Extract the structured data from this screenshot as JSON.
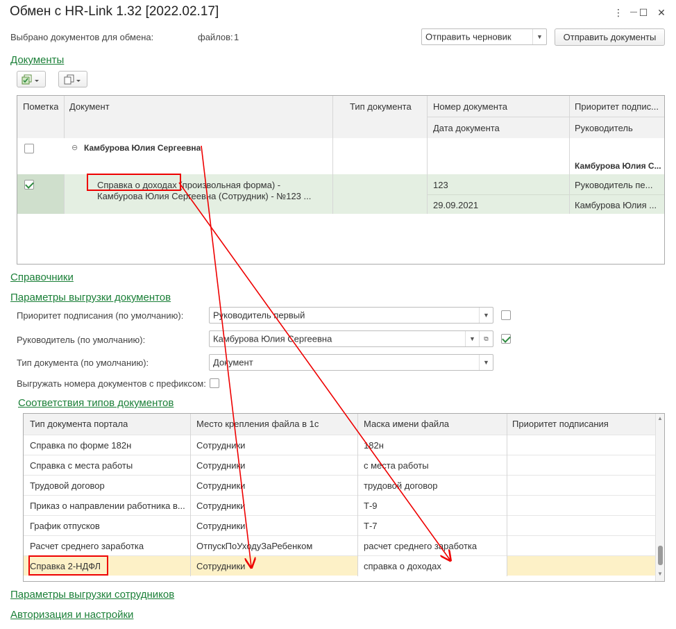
{
  "window": {
    "title": "Обмен с HR-Link 1.32 [2022.02.17]",
    "menu_glyph": "⋮",
    "minimize_glyph": "—",
    "maximize_glyph": "☐",
    "close_glyph": "✕"
  },
  "top": {
    "selected_label": "Выбрано документов для обмена:",
    "files_label": "файлов:",
    "files_count": "1",
    "mode_select": "Отправить черновик",
    "send_button": "Отправить документы"
  },
  "sections": {
    "documents": "Документы",
    "references": "Справочники",
    "export_params": "Параметры выгрузки документов",
    "type_mapping": "Соответствия типов документов",
    "employee_export": "Параметры выгрузки сотрудников",
    "auth": "Авторизация и настройки"
  },
  "docs_table": {
    "headers": {
      "mark": "Пометка",
      "document": "Документ",
      "doc_type": "Тип документа",
      "doc_number": "Номер документа",
      "doc_date": "Дата документа",
      "priority": "Приоритет подпис...",
      "manager": "Руководитель"
    },
    "group": {
      "name": "Камбурова Юлия Сергеевна",
      "right_text": "Камбурова Юлия С..."
    },
    "row": {
      "doc_line1": "Справка о доходах (произвольная форма) -",
      "doc_line2": "Камбурова Юлия Сергеевна (Сотрудник) - №123 ...",
      "number": "123",
      "date": "29.09.2021",
      "priority": "Руководитель пе...",
      "manager": "Камбурова Юлия ...",
      "checked": true
    }
  },
  "params": {
    "priority_label": "Приоритет подписания (по умолчанию):",
    "priority_value": "Руководитель первый",
    "manager_label": "Руководитель (по умолчанию):",
    "manager_value": "Камбурова Юлия Сергеевна",
    "doctype_label": "Тип документа (по умолчанию):",
    "doctype_value": "Документ",
    "prefix_label": "Выгружать номера документов с префиксом:"
  },
  "mapping_table": {
    "headers": [
      "Тип документа портала",
      "Место крепления файла в 1с",
      "Маска имени файла",
      "Приоритет подписания"
    ],
    "rows": [
      [
        "Справка по форме 182н",
        "Сотрудники",
        "182н",
        ""
      ],
      [
        "Справка с места работы",
        "Сотрудники",
        "с места работы",
        ""
      ],
      [
        "Трудовой договор",
        "Сотрудники",
        "трудовой договор",
        ""
      ],
      [
        "Приказ о направлении работника в...",
        "Сотрудники",
        "Т-9",
        ""
      ],
      [
        "График отпусков",
        "Сотрудники",
        "Т-7",
        ""
      ],
      [
        "Расчет среднего заработка",
        "ОтпускПоУходуЗаРебенком",
        "расчет среднего заработка",
        ""
      ],
      [
        "Справка 2-НДФЛ",
        "Сотрудники",
        "справка о доходах",
        ""
      ]
    ]
  },
  "colors": {
    "accent_green": "#1a7f37",
    "selected_row": "#e4efe2",
    "active_row": "#fdf1c7",
    "annotation_red": "#e00000"
  }
}
